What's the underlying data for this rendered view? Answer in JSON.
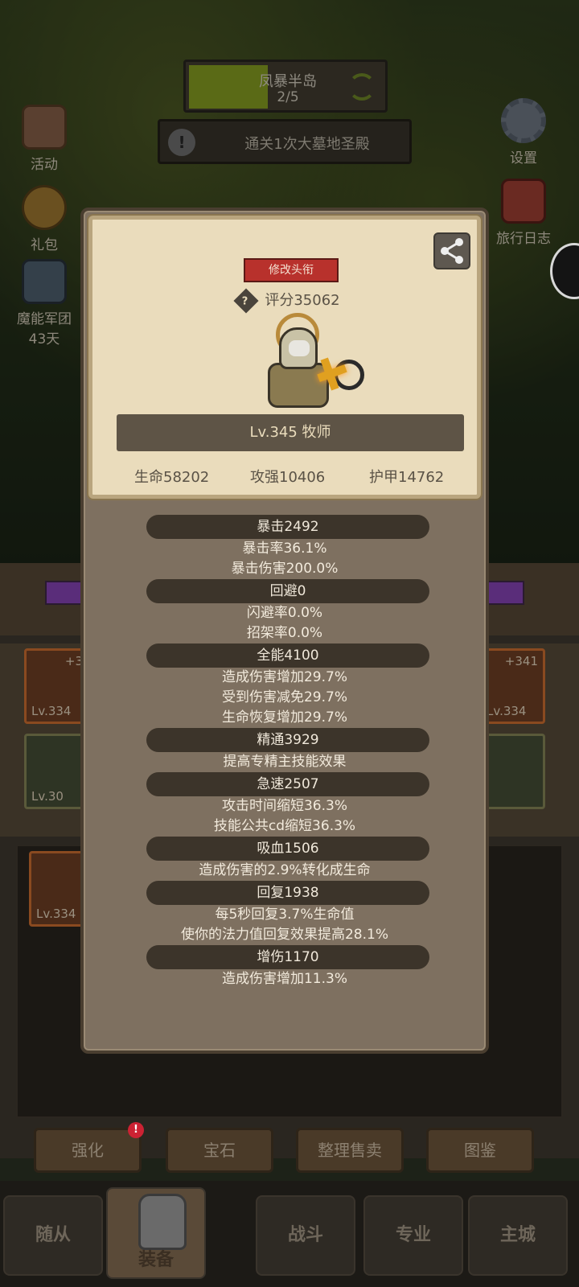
{
  "hud": {
    "stage_name": "凤暴半岛",
    "stage_progress_text": "2/5",
    "stage_progress_fraction": 0.4,
    "quest_text": "通关1次大墓地圣殿",
    "quest_alert": "!"
  },
  "side_left": [
    {
      "label": "活动",
      "icon": "event-scroll-icon"
    },
    {
      "label": "礼包",
      "icon": "gift-icon"
    },
    {
      "label": "魔能军团",
      "sub": "43天",
      "icon": "legion-helmet-icon"
    }
  ],
  "side_right": [
    {
      "label": "设置",
      "icon": "gear-icon"
    },
    {
      "label": "旅行日志",
      "icon": "journal-icon"
    }
  ],
  "modal": {
    "title_button": "修改头衔",
    "score_label": "评分35062",
    "help_glyph": "?",
    "level_class": "Lv.345 牧师",
    "basic_stats": [
      "生命58202",
      "攻强10406",
      "护甲14762"
    ],
    "stats": [
      {
        "header": "暴击2492",
        "lines": [
          "暴击率36.1%",
          "暴击伤害200.0%"
        ]
      },
      {
        "header": "回避0",
        "lines": [
          "闪避率0.0%",
          "招架率0.0%"
        ]
      },
      {
        "header": "全能4100",
        "lines": [
          "造成伤害增加29.7%",
          "受到伤害减免29.7%",
          "生命恢复增加29.7%"
        ]
      },
      {
        "header": "精通3929",
        "lines": [
          "提高专精主技能效果"
        ]
      },
      {
        "header": "急速2507",
        "lines": [
          "攻击时间缩短36.3%",
          "技能公共cd缩短36.3%"
        ]
      },
      {
        "header": "吸血1506",
        "lines": [
          "造成伤害的2.9%转化成生命"
        ]
      },
      {
        "header": "回复1938",
        "lines": [
          "每5秒回复3.7%生命值",
          "使你的法力值回复效果提高28.1%"
        ]
      },
      {
        "header": "增伤1170",
        "lines": [
          "造成伤害增加11.3%"
        ]
      }
    ]
  },
  "gear_slots": [
    {
      "plus": "+3",
      "level": "Lv.334"
    },
    {
      "plus": "+341",
      "level": "Lv.334"
    },
    {
      "level": "Lv.30"
    },
    {
      "level": "Lv.334"
    }
  ],
  "actions": {
    "enhance": "强化",
    "enhance_badge": "!",
    "gem": "宝石",
    "sort_sell": "整理售卖",
    "codex": "图鉴"
  },
  "nav": {
    "follower": "随从",
    "equip": "装备",
    "battle": "战斗",
    "profession": "专业",
    "city": "主城"
  }
}
